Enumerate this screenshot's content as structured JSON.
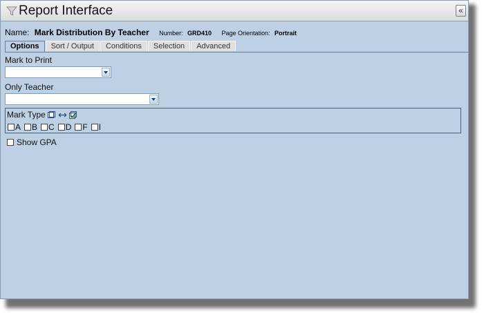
{
  "window": {
    "title": "Report Interface",
    "collapse_label": "«"
  },
  "report": {
    "name_label": "Name:",
    "name": "Mark Distribution By Teacher",
    "number_label": "Number:",
    "number": "GRD410",
    "orientation_label": "Page Orientation:",
    "orientation": "Portrait"
  },
  "tabs": [
    {
      "label": "Options",
      "active": true
    },
    {
      "label": "Sort / Output",
      "active": false
    },
    {
      "label": "Conditions",
      "active": false
    },
    {
      "label": "Selection",
      "active": false
    },
    {
      "label": "Advanced",
      "active": false
    }
  ],
  "options": {
    "mark_to_print": {
      "label": "Mark to Print",
      "value": ""
    },
    "only_teacher": {
      "label": "Only Teacher",
      "value": ""
    },
    "mark_type": {
      "label": "Mark Type",
      "items": [
        {
          "label": "A",
          "checked": false
        },
        {
          "label": "B",
          "checked": false
        },
        {
          "label": "C",
          "checked": false
        },
        {
          "label": "D",
          "checked": false
        },
        {
          "label": "F",
          "checked": false
        },
        {
          "label": "I",
          "checked": false
        }
      ]
    },
    "show_gpa": {
      "label": "Show GPA",
      "checked": false
    }
  },
  "colors": {
    "panel_bg": "#bdd0e4",
    "tab_bg": "#e0e0e0",
    "border": "#6a7e96"
  }
}
